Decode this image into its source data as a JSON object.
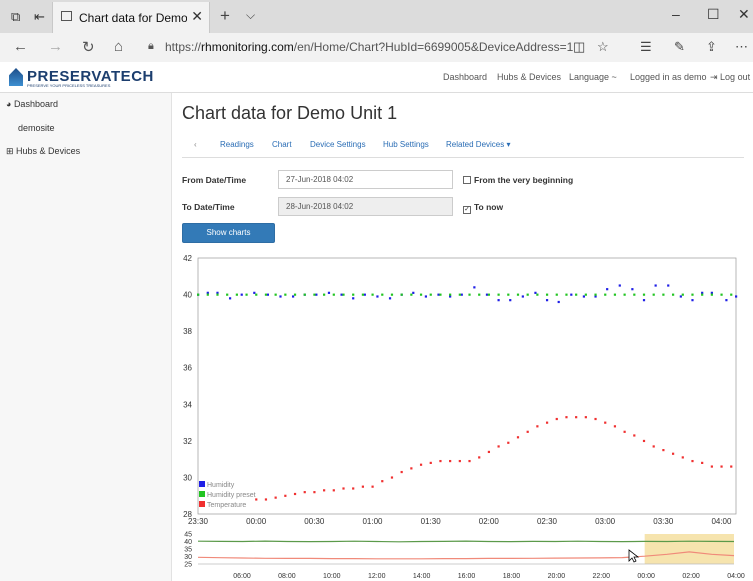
{
  "browser": {
    "tab_title": "Chart data for Demo Ur",
    "url_prefix": "https://",
    "url_domain": "rhmonitoring.com",
    "url_path": "/en/Home/Chart?HubId=6699005&DeviceAddress=1"
  },
  "site": {
    "logo_name": "PRESERVATECH",
    "logo_tagline": "PRESERVE YOUR PRICELESS TREASURES",
    "nav": {
      "dashboard": "Dashboard",
      "hubs": "Hubs & Devices",
      "language": "Language ~",
      "logged_in": "Logged in as demo",
      "logout": "Log out"
    }
  },
  "sidebar": {
    "items": [
      {
        "label": "Dashboard",
        "icon": "dashboard-icon"
      },
      {
        "label": "demosite"
      },
      {
        "label": "Hubs & Devices",
        "icon": "sitemap-icon"
      }
    ]
  },
  "main": {
    "title": "Chart data for Demo Unit 1",
    "subnav": {
      "back": "‹",
      "readings": "Readings",
      "chart": "Chart",
      "device_settings": "Device Settings",
      "hub_settings": "Hub Settings",
      "related": "Related Devices ▾"
    },
    "form": {
      "from_label": "From Date/Time",
      "from_value": "27-Jun-2018 04:02",
      "from_beginning": "From the very beginning",
      "to_label": "To Date/Time",
      "to_value": "28-Jun-2018 04:02",
      "to_now": "To now",
      "show_button": "Show charts"
    }
  },
  "chart_data": [
    {
      "type": "scatter",
      "ylim": [
        28,
        42
      ],
      "yticks": [
        "42",
        "40",
        "38",
        "36",
        "34",
        "32",
        "30",
        "28"
      ],
      "xticks": [
        "23:30",
        "00:00",
        "00:30",
        "01:00",
        "01:30",
        "02:00",
        "02:30",
        "03:00",
        "03:30",
        "04:00"
      ],
      "legend": [
        {
          "name": "Humidity",
          "color": "#1f1fe6"
        },
        {
          "name": "Humidity preset",
          "color": "#22c422"
        },
        {
          "name": "Temperature",
          "color": "#f03030"
        }
      ],
      "series": [
        {
          "name": "Humidity",
          "color": "#1f1fe6",
          "x": [
            0.0,
            0.1,
            0.2,
            0.33,
            0.45,
            0.58,
            0.72,
            0.85,
            0.98,
            1.1,
            1.22,
            1.35,
            1.48,
            1.6,
            1.72,
            1.85,
            1.98,
            2.1,
            2.22,
            2.35,
            2.48,
            2.6,
            2.72,
            2.85,
            2.98,
            3.1,
            3.22,
            3.35,
            3.48,
            3.6,
            3.72,
            3.85,
            3.98,
            4.1,
            4.22,
            4.35,
            4.48,
            4.6,
            4.72,
            4.85,
            4.98,
            5.1,
            5.2,
            5.3,
            5.45,
            5.55
          ],
          "y": [
            40.0,
            40.1,
            40.1,
            39.8,
            40.0,
            40.1,
            40.0,
            39.9,
            39.9,
            40.0,
            40.0,
            40.1,
            40.0,
            39.8,
            40.0,
            39.9,
            39.8,
            40.0,
            40.1,
            39.9,
            40.0,
            39.9,
            40.0,
            40.4,
            40.0,
            39.7,
            39.7,
            39.9,
            40.1,
            39.7,
            39.6,
            40.0,
            39.9,
            39.9,
            40.3,
            40.5,
            40.3,
            39.7,
            40.5,
            40.5,
            39.9,
            39.7,
            40.1,
            40.1,
            39.7,
            39.9
          ]
        },
        {
          "name": "Humidity preset",
          "color": "#22c422",
          "x": [
            0.0,
            0.1,
            0.2,
            0.3,
            0.4,
            0.5,
            0.6,
            0.7,
            0.8,
            0.9,
            1.0,
            1.1,
            1.2,
            1.3,
            1.4,
            1.5,
            1.6,
            1.7,
            1.8,
            1.9,
            2.0,
            2.1,
            2.2,
            2.3,
            2.4,
            2.5,
            2.6,
            2.7,
            2.8,
            2.9,
            3.0,
            3.1,
            3.2,
            3.3,
            3.4,
            3.5,
            3.6,
            3.7,
            3.8,
            3.9,
            4.0,
            4.1,
            4.2,
            4.3,
            4.4,
            4.5,
            4.6,
            4.7,
            4.8,
            4.9,
            5.0,
            5.1,
            5.2,
            5.3,
            5.4,
            5.5
          ],
          "y": [
            40,
            40,
            40,
            40,
            40,
            40,
            40,
            40,
            40,
            40,
            40,
            40,
            40,
            40,
            40,
            40,
            40,
            40,
            40,
            40,
            40,
            40,
            40,
            40,
            40,
            40,
            40,
            40,
            40,
            40,
            40,
            40,
            40,
            40,
            40,
            40,
            40,
            40,
            40,
            40,
            40,
            40,
            40,
            40,
            40,
            40,
            40,
            40,
            40,
            40,
            40,
            40,
            40,
            40,
            40,
            40
          ]
        },
        {
          "name": "Temperature",
          "color": "#f03030",
          "x": [
            0.6,
            0.7,
            0.8,
            0.9,
            1.0,
            1.1,
            1.2,
            1.3,
            1.4,
            1.5,
            1.6,
            1.7,
            1.8,
            1.9,
            2.0,
            2.1,
            2.2,
            2.3,
            2.4,
            2.5,
            2.6,
            2.7,
            2.8,
            2.9,
            3.0,
            3.1,
            3.2,
            3.3,
            3.4,
            3.5,
            3.6,
            3.7,
            3.8,
            3.9,
            4.0,
            4.1,
            4.2,
            4.3,
            4.4,
            4.5,
            4.6,
            4.7,
            4.8,
            4.9,
            5.0,
            5.1,
            5.2,
            5.3,
            5.4,
            5.5
          ],
          "y": [
            28.8,
            28.8,
            28.9,
            29.0,
            29.1,
            29.2,
            29.2,
            29.3,
            29.3,
            29.4,
            29.4,
            29.5,
            29.5,
            29.8,
            30.0,
            30.3,
            30.5,
            30.7,
            30.8,
            30.9,
            30.9,
            30.9,
            30.9,
            31.1,
            31.4,
            31.7,
            31.9,
            32.2,
            32.5,
            32.8,
            33.0,
            33.2,
            33.3,
            33.3,
            33.3,
            33.2,
            33.0,
            32.8,
            32.5,
            32.3,
            32.0,
            31.7,
            31.5,
            31.3,
            31.1,
            30.9,
            30.8,
            30.6,
            30.6,
            30.6
          ]
        }
      ]
    },
    {
      "type": "line",
      "ylim": [
        25,
        45
      ],
      "yticks": [
        "45",
        "40",
        "35",
        "30",
        "25"
      ],
      "xticks": [
        "06:00",
        "08:00",
        "10:00",
        "12:00",
        "14:00",
        "16:00",
        "18:00",
        "20:00",
        "22:00",
        "00:00",
        "02:00",
        "04:00"
      ],
      "series": [
        {
          "name": "Humidity",
          "color": "#5b9a4a",
          "y": [
            40.2,
            40.1,
            40.0,
            40.3,
            40.0,
            39.9,
            40.0,
            40.2,
            40.0,
            39.8,
            40.0,
            40.1,
            40.3,
            40.0,
            39.9,
            40.1,
            40.0,
            40.2,
            40.0,
            39.9,
            40.1,
            40.0,
            40.2,
            40.1,
            40.0
          ]
        },
        {
          "name": "Temperature",
          "color": "#f08a7a",
          "y": [
            29.5,
            29.2,
            29.0,
            28.8,
            28.7,
            28.7,
            28.6,
            28.6,
            28.5,
            28.5,
            28.5,
            28.6,
            28.6,
            28.7,
            28.7,
            28.8,
            28.9,
            29.0,
            29.1,
            29.3,
            30.2,
            31.5,
            33.1,
            31.5,
            30.6
          ]
        }
      ],
      "selected_range": "00:00 – 04:00"
    }
  ]
}
